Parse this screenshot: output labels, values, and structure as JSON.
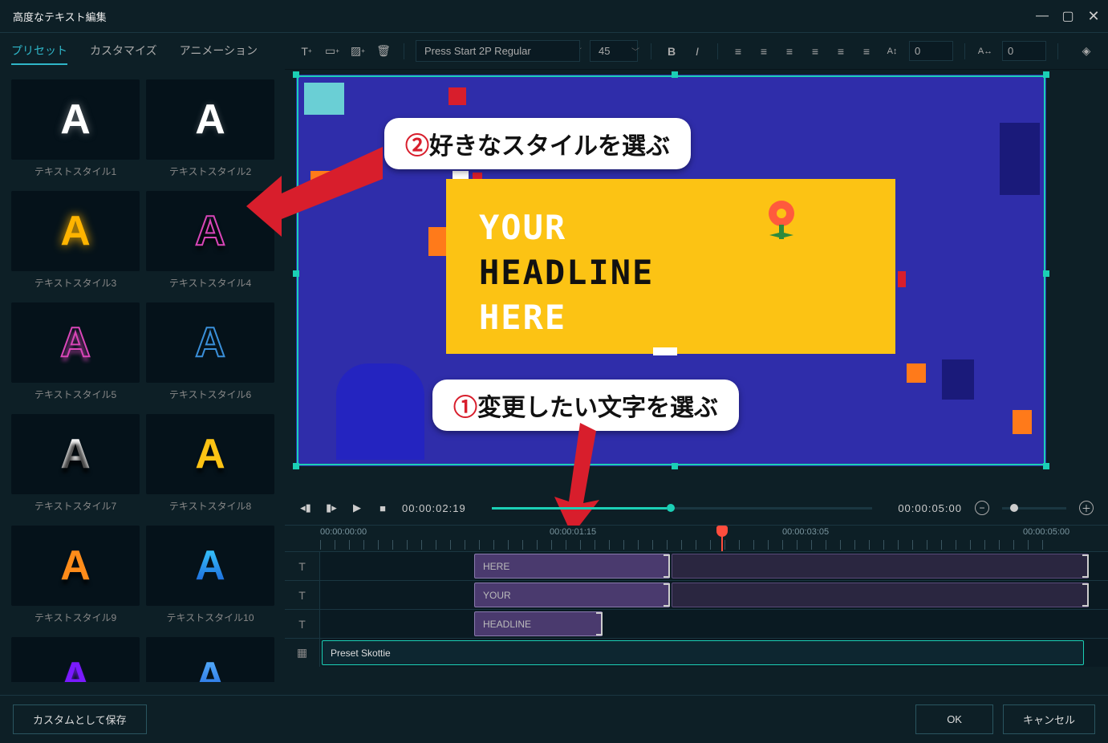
{
  "window": {
    "title": "高度なテキスト編集"
  },
  "tabs": {
    "preset": "プリセット",
    "customize": "カスタマイズ",
    "animation": "アニメーション"
  },
  "styles": [
    {
      "label": "テキストスタイル1",
      "fill": "#fff",
      "stroke": "none",
      "shadow": "0 0 10px rgba(200,200,200,.5)"
    },
    {
      "label": "テキストスタイル2",
      "fill": "#fff",
      "stroke": "none",
      "shadow": "0 0 8px rgba(200,200,200,.3)"
    },
    {
      "label": "テキストスタイル3",
      "fill": "#ffb400",
      "stroke": "none",
      "shadow": "0 0 12px #ffb400"
    },
    {
      "label": "テキストスタイル4",
      "fill": "none",
      "stroke": "#d946b8",
      "shadow": "0 6px 6px rgba(0,0,0,.6)"
    },
    {
      "label": "テキストスタイル5",
      "fill": "none",
      "stroke": "#d946b8",
      "shadow": "0 6px 4px rgba(217,70,184,.4)"
    },
    {
      "label": "テキストスタイル6",
      "fill": "none",
      "stroke": "#3a8fd9",
      "shadow": "none"
    },
    {
      "label": "テキストスタイル7",
      "fill": "#fff",
      "stroke": "none",
      "shadow": "0 6px 4px rgba(0,0,0,.7)",
      "grad": "linear-gradient(#fff,#bbb)"
    },
    {
      "label": "テキストスタイル8",
      "fill": "#fcc314",
      "stroke": "none",
      "shadow": "0 6px 4px rgba(0,0,0,.6)"
    },
    {
      "label": "テキストスタイル9",
      "fill": "#ff8c1a",
      "stroke": "none",
      "shadow": "0 6px 4px rgba(0,0,0,.6)"
    },
    {
      "label": "テキストスタイル10",
      "fill": "none",
      "stroke": "none",
      "shadow": "none",
      "grad": "linear-gradient(#3ad0ff,#1a5fd9)"
    },
    {
      "label": "",
      "fill": "#7a1aff",
      "stroke": "none",
      "shadow": "0 6px 4px rgba(122,26,255,.6)"
    },
    {
      "label": "",
      "fill": "none",
      "stroke": "none",
      "shadow": "none",
      "grad": "linear-gradient(#5ab4ff,#1a5fd9)"
    }
  ],
  "toolbar": {
    "font_name": "Press Start 2P Regular",
    "font_size": "45",
    "line_height": "0",
    "letter_spacing": "0"
  },
  "preview": {
    "text_your": "YOUR",
    "text_headline": "HEADLINE",
    "text_here": "HERE"
  },
  "annotations": {
    "step2": {
      "circled": "②",
      "rest": "好きなスタイルを選ぶ"
    },
    "step1": {
      "circled": "①",
      "rest": "変更したい文字を選ぶ"
    }
  },
  "playback": {
    "current_time": "00:00:02:19",
    "total_time": "00:00:05:00"
  },
  "ruler": {
    "t0": "00:00:00:00",
    "t1": "00:00:01:15",
    "t2": "00:00:03:05",
    "t3": "00:00:05:00"
  },
  "timeline": {
    "clips": [
      {
        "label": "HERE"
      },
      {
        "label": "YOUR"
      },
      {
        "label": "HEADLINE"
      },
      {
        "label": "Preset Skottie"
      }
    ]
  },
  "footer": {
    "save_custom": "カスタムとして保存",
    "ok": "OK",
    "cancel": "キャンセル"
  }
}
